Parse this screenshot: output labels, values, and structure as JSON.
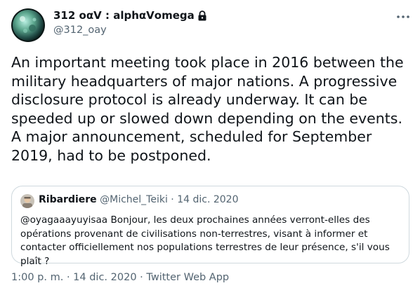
{
  "author": {
    "name": "312 οαꓦ : alphαꓦomega",
    "handle": "@312_oay",
    "verified_lock": true
  },
  "tweet": {
    "text": "An important meeting took place in 2016 between the military headquarters of major nations. A progressive disclosure protocol is already underway. It can be speeded up or slowed down depending on the events. A major announcement, scheduled for September 2019, had to be postponed."
  },
  "quoted_tweet": {
    "name": "Ribardiere",
    "handle": "@Michel_Teiki",
    "separator": "·",
    "date": "14 dic. 2020",
    "text": "@oyagaaayuyisaa Bonjour, les deux prochaines années verront-elles des opérations provenant de civilisations non-terrestres, visant à informer et contacter officiellement nos populations terrestres de leur présence, s'il vous plaît ?"
  },
  "meta": {
    "time": "1:00 p. m.",
    "date": "14 dic. 2020",
    "source": "Twitter Web App",
    "separator": "·"
  },
  "colors": {
    "text_primary": "#0f1419",
    "text_secondary": "#536471",
    "border": "#cfd9de"
  }
}
